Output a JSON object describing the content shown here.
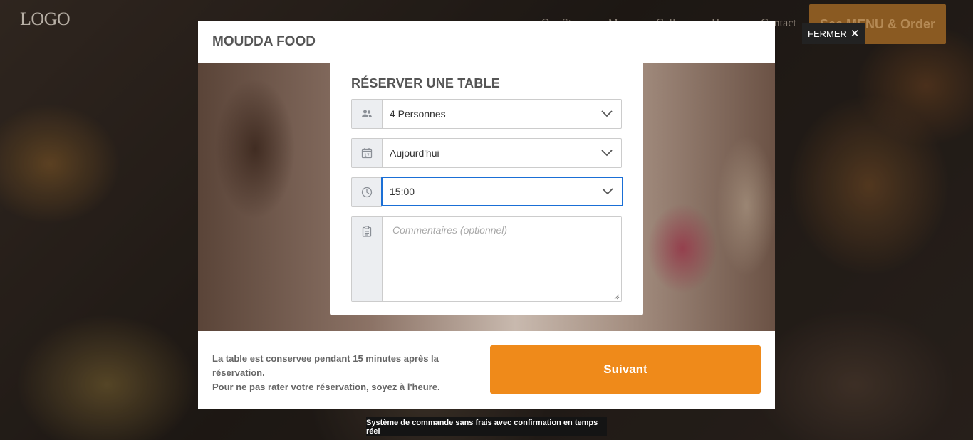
{
  "site": {
    "logo": "LOGO",
    "nav_links": [
      "Our Story",
      "Menu",
      "Gallery",
      "Hours",
      "Contact"
    ],
    "cta": "See MENU & Order"
  },
  "modal": {
    "title": "MOUDDA FOOD",
    "close_label": "FERMER",
    "form_heading": "RÉSERVER UNE TABLE",
    "fields": {
      "guests": {
        "value": "4 Personnes",
        "icon": "people-icon"
      },
      "date": {
        "value": "Aujourd'hui",
        "icon": "calendar-icon"
      },
      "time": {
        "value": "15:00",
        "icon": "clock-icon"
      },
      "comments": {
        "placeholder": "Commentaires (optionnel)",
        "icon": "clipboard-icon"
      }
    },
    "footer_note_line1": "La table est conservee pendant 15 minutes après la réservation.",
    "footer_note_line2": "Pour ne pas rater votre réservation, soyez à l'heure.",
    "next_label": "Suivant"
  },
  "tooltip": "Système de commande sans frais avec confirmation en temps réel",
  "colors": {
    "accent": "#ef8a1a",
    "focus": "#1a6fd6",
    "close_bg": "#222222"
  }
}
